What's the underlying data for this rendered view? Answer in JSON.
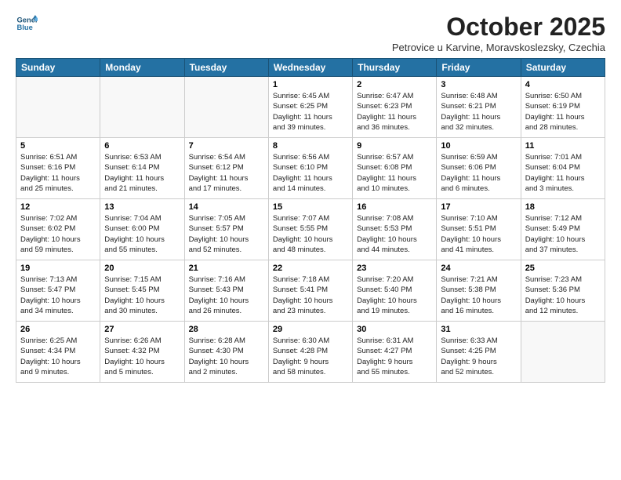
{
  "logo": {
    "line1": "General",
    "line2": "Blue"
  },
  "title": "October 2025",
  "subtitle": "Petrovice u Karvine, Moravskoslezsky, Czechia",
  "headers": [
    "Sunday",
    "Monday",
    "Tuesday",
    "Wednesday",
    "Thursday",
    "Friday",
    "Saturday"
  ],
  "weeks": [
    [
      {
        "day": "",
        "text": ""
      },
      {
        "day": "",
        "text": ""
      },
      {
        "day": "",
        "text": ""
      },
      {
        "day": "1",
        "text": "Sunrise: 6:45 AM\nSunset: 6:25 PM\nDaylight: 11 hours\nand 39 minutes."
      },
      {
        "day": "2",
        "text": "Sunrise: 6:47 AM\nSunset: 6:23 PM\nDaylight: 11 hours\nand 36 minutes."
      },
      {
        "day": "3",
        "text": "Sunrise: 6:48 AM\nSunset: 6:21 PM\nDaylight: 11 hours\nand 32 minutes."
      },
      {
        "day": "4",
        "text": "Sunrise: 6:50 AM\nSunset: 6:19 PM\nDaylight: 11 hours\nand 28 minutes."
      }
    ],
    [
      {
        "day": "5",
        "text": "Sunrise: 6:51 AM\nSunset: 6:16 PM\nDaylight: 11 hours\nand 25 minutes."
      },
      {
        "day": "6",
        "text": "Sunrise: 6:53 AM\nSunset: 6:14 PM\nDaylight: 11 hours\nand 21 minutes."
      },
      {
        "day": "7",
        "text": "Sunrise: 6:54 AM\nSunset: 6:12 PM\nDaylight: 11 hours\nand 17 minutes."
      },
      {
        "day": "8",
        "text": "Sunrise: 6:56 AM\nSunset: 6:10 PM\nDaylight: 11 hours\nand 14 minutes."
      },
      {
        "day": "9",
        "text": "Sunrise: 6:57 AM\nSunset: 6:08 PM\nDaylight: 11 hours\nand 10 minutes."
      },
      {
        "day": "10",
        "text": "Sunrise: 6:59 AM\nSunset: 6:06 PM\nDaylight: 11 hours\nand 6 minutes."
      },
      {
        "day": "11",
        "text": "Sunrise: 7:01 AM\nSunset: 6:04 PM\nDaylight: 11 hours\nand 3 minutes."
      }
    ],
    [
      {
        "day": "12",
        "text": "Sunrise: 7:02 AM\nSunset: 6:02 PM\nDaylight: 10 hours\nand 59 minutes."
      },
      {
        "day": "13",
        "text": "Sunrise: 7:04 AM\nSunset: 6:00 PM\nDaylight: 10 hours\nand 55 minutes."
      },
      {
        "day": "14",
        "text": "Sunrise: 7:05 AM\nSunset: 5:57 PM\nDaylight: 10 hours\nand 52 minutes."
      },
      {
        "day": "15",
        "text": "Sunrise: 7:07 AM\nSunset: 5:55 PM\nDaylight: 10 hours\nand 48 minutes."
      },
      {
        "day": "16",
        "text": "Sunrise: 7:08 AM\nSunset: 5:53 PM\nDaylight: 10 hours\nand 44 minutes."
      },
      {
        "day": "17",
        "text": "Sunrise: 7:10 AM\nSunset: 5:51 PM\nDaylight: 10 hours\nand 41 minutes."
      },
      {
        "day": "18",
        "text": "Sunrise: 7:12 AM\nSunset: 5:49 PM\nDaylight: 10 hours\nand 37 minutes."
      }
    ],
    [
      {
        "day": "19",
        "text": "Sunrise: 7:13 AM\nSunset: 5:47 PM\nDaylight: 10 hours\nand 34 minutes."
      },
      {
        "day": "20",
        "text": "Sunrise: 7:15 AM\nSunset: 5:45 PM\nDaylight: 10 hours\nand 30 minutes."
      },
      {
        "day": "21",
        "text": "Sunrise: 7:16 AM\nSunset: 5:43 PM\nDaylight: 10 hours\nand 26 minutes."
      },
      {
        "day": "22",
        "text": "Sunrise: 7:18 AM\nSunset: 5:41 PM\nDaylight: 10 hours\nand 23 minutes."
      },
      {
        "day": "23",
        "text": "Sunrise: 7:20 AM\nSunset: 5:40 PM\nDaylight: 10 hours\nand 19 minutes."
      },
      {
        "day": "24",
        "text": "Sunrise: 7:21 AM\nSunset: 5:38 PM\nDaylight: 10 hours\nand 16 minutes."
      },
      {
        "day": "25",
        "text": "Sunrise: 7:23 AM\nSunset: 5:36 PM\nDaylight: 10 hours\nand 12 minutes."
      }
    ],
    [
      {
        "day": "26",
        "text": "Sunrise: 6:25 AM\nSunset: 4:34 PM\nDaylight: 10 hours\nand 9 minutes."
      },
      {
        "day": "27",
        "text": "Sunrise: 6:26 AM\nSunset: 4:32 PM\nDaylight: 10 hours\nand 5 minutes."
      },
      {
        "day": "28",
        "text": "Sunrise: 6:28 AM\nSunset: 4:30 PM\nDaylight: 10 hours\nand 2 minutes."
      },
      {
        "day": "29",
        "text": "Sunrise: 6:30 AM\nSunset: 4:28 PM\nDaylight: 9 hours\nand 58 minutes."
      },
      {
        "day": "30",
        "text": "Sunrise: 6:31 AM\nSunset: 4:27 PM\nDaylight: 9 hours\nand 55 minutes."
      },
      {
        "day": "31",
        "text": "Sunrise: 6:33 AM\nSunset: 4:25 PM\nDaylight: 9 hours\nand 52 minutes."
      },
      {
        "day": "",
        "text": ""
      }
    ]
  ]
}
